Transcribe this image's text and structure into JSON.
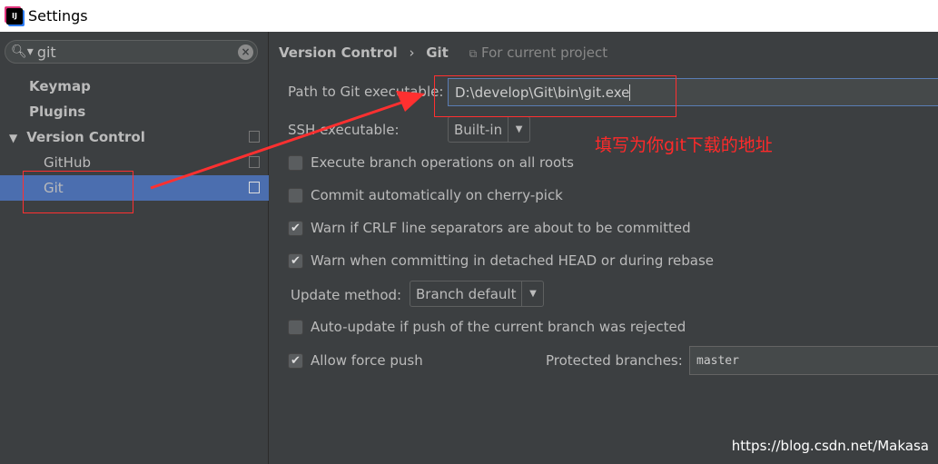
{
  "window": {
    "title": "Settings",
    "logo": "IJ"
  },
  "sidebar": {
    "search_value": "git",
    "items": [
      {
        "label": "Keymap"
      },
      {
        "label": "Plugins"
      },
      {
        "label": "Version Control"
      },
      {
        "label": "GitHub"
      },
      {
        "label": "Git"
      }
    ]
  },
  "breadcrumb": {
    "parent": "Version Control",
    "sep": "›",
    "current": "Git",
    "scope": "For current project"
  },
  "form": {
    "path_label": "Path to Git executable:",
    "path_value": "D:\\develop\\Git\\bin\\git.exe",
    "ssh_label": "SSH executable:",
    "ssh_value": "Built-in",
    "checks": [
      {
        "label": "Execute branch operations on all roots",
        "checked": false
      },
      {
        "label": "Commit automatically on cherry-pick",
        "checked": false
      },
      {
        "label": "Warn if CRLF line separators are about to be committed",
        "checked": true
      },
      {
        "label": "Warn when committing in detached HEAD or during rebase",
        "checked": true
      }
    ],
    "update_label": "Update method:",
    "update_value": "Branch default",
    "autoupdate": {
      "label": "Auto-update if push of the current branch was rejected",
      "checked": false
    },
    "force": {
      "label": "Allow force push",
      "checked": true
    },
    "protected_label": "Protected branches:",
    "protected_value": "master"
  },
  "annotation": {
    "note": "填写为你git下载的地址",
    "color": "#ff2a2a"
  },
  "watermark": "https://blog.csdn.net/Makasa"
}
